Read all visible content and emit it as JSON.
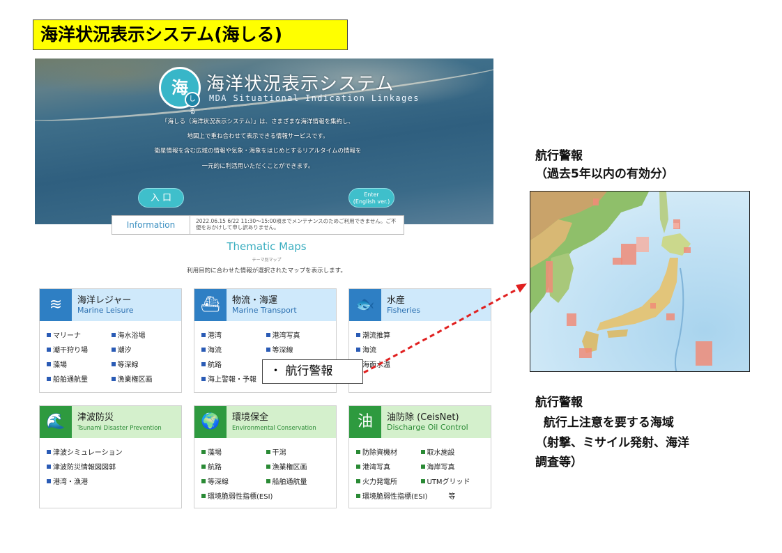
{
  "slide": {
    "title": "海洋状況表示システム(海しる)"
  },
  "hero": {
    "logo_text": "海",
    "logo_sub": "しる",
    "title_jp": "海洋状況表示システム",
    "title_en": "MDA Situational Indication Linkages",
    "desc_lines": [
      "「海しる（海洋状況表示システム）」は、さまざまな海洋情報を集約し、",
      "地図上で重ね合わせて表示できる情報サービスです。",
      "衛星情報を含む広域の情報や気象・海象をはじめとするリアルタイムの情報を",
      "一元的に利活用いただくことができます。"
    ],
    "enter_jp": "入 口",
    "enter_en_1": "Enter",
    "enter_en_2": "(English ver.)"
  },
  "info": {
    "label": "Information",
    "text": "2022.06.15  6/22 11:30～15:00頃までメンテナンスのためご利用できません。ご不便をおかけして申し訳ありません。"
  },
  "thematic": {
    "title": "Thematic Maps",
    "subtitle": "テーマ別マップ",
    "desc": "利用目的に合わせた情報が選択されたマップを表示します。"
  },
  "cards": {
    "leisure": {
      "jp": "海洋レジャー",
      "en": "Marine Leisure",
      "items": [
        "マリーナ",
        "海水浴場",
        "潮干狩り場",
        "潮汐",
        "藻場",
        "等深線",
        "船舶通航量",
        "漁業権区画"
      ]
    },
    "transport": {
      "jp": "物流・海運",
      "en": "Marine Transport",
      "items": [
        "港湾",
        "港湾写真",
        "海流",
        "等深線",
        "航路",
        "",
        "海上警報・予報"
      ]
    },
    "fisheries": {
      "jp": "水産",
      "en": "Fisheries",
      "items": [
        "潮流推算",
        "海流",
        "海面水温"
      ]
    },
    "tsunami": {
      "jp": "津波防災",
      "en": "Tsunami Disaster Prevention",
      "items": [
        "津波シミュレーション",
        "津波防災情報図図郭",
        "港湾・漁港"
      ]
    },
    "environment": {
      "jp": "環境保全",
      "en": "Environmental Conservation",
      "items": [
        "藻場",
        "干潟",
        "航路",
        "漁業権区画",
        "等深線",
        "船舶通航量",
        "環境脆弱性指標(ESI)"
      ]
    },
    "oil": {
      "jp": "油防除 (CeisNet)",
      "en": "Discharge Oil Control",
      "items": [
        "防除資機材",
        "取水施設",
        "港湾写真",
        "海岸写真",
        "火力発電所",
        "UTMグリッド",
        "環境脆弱性指標(ESI)"
      ],
      "suffix": "等"
    }
  },
  "callout": {
    "text": "・ 航行警報"
  },
  "right": {
    "title1_line1": "航行警報",
    "title1_line2": "（過去5年以内の有効分）",
    "title2_line1": "航行警報",
    "title2_line2": "  航行上注意を要する海域",
    "title2_line3": "（射撃、ミサイル発射、海洋",
    "title2_line4": "調査等）"
  },
  "colors": {
    "title_bg": "#ffff00",
    "leisure_blue": "#2e7fc4",
    "env_green": "#2e9a3f",
    "arrow_red": "#e02020",
    "warning_area": "#f08c78"
  }
}
